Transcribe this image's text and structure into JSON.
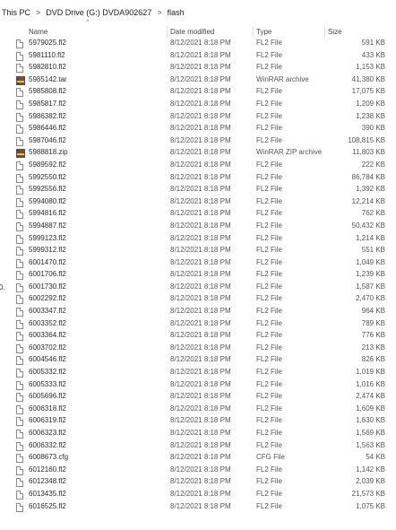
{
  "breadcrumb": [
    "This PC",
    "DVD Drive (G:) DVDA902627",
    "flash"
  ],
  "columns": {
    "name": "Name",
    "date": "Date modified",
    "type": "Type",
    "size": "Size"
  },
  "leftnav_fragment": "0.",
  "files": [
    {
      "name": "5979025.fl2",
      "date": "8/12/2021 8:18 PM",
      "type": "FL2 File",
      "size": "591 KB",
      "icon": "fl2-file-icon"
    },
    {
      "name": "5981110.fl2",
      "date": "8/12/2021 8:18 PM",
      "type": "FL2 File",
      "size": "433 KB",
      "icon": "fl2-file-icon"
    },
    {
      "name": "5982810.fl2",
      "date": "8/12/2021 8:18 PM",
      "type": "FL2 File",
      "size": "1,153 KB",
      "icon": "fl2-file-icon"
    },
    {
      "name": "5985142.tar",
      "date": "8/12/2021 8:18 PM",
      "type": "WinRAR archive",
      "size": "41,380 KB",
      "icon": "winrar-archive-icon"
    },
    {
      "name": "5985808.fl2",
      "date": "8/12/2021 8:18 PM",
      "type": "FL2 File",
      "size": "17,075 KB",
      "icon": "fl2-file-icon"
    },
    {
      "name": "5985817.fl2",
      "date": "8/12/2021 8:18 PM",
      "type": "FL2 File",
      "size": "1,209 KB",
      "icon": "fl2-file-icon"
    },
    {
      "name": "5986382.fl2",
      "date": "8/12/2021 8:18 PM",
      "type": "FL2 File",
      "size": "1,238 KB",
      "icon": "fl2-file-icon"
    },
    {
      "name": "5986446.fl2",
      "date": "8/12/2021 8:18 PM",
      "type": "FL2 File",
      "size": "390 KB",
      "icon": "fl2-file-icon"
    },
    {
      "name": "5987046.fl2",
      "date": "8/12/2021 8:18 PM",
      "type": "FL2 File",
      "size": "108,815 KB",
      "icon": "fl2-file-icon"
    },
    {
      "name": "5988818.zip",
      "date": "8/12/2021 8:18 PM",
      "type": "WinRAR ZIP archive",
      "size": "11,803 KB",
      "icon": "winrar-archive-icon"
    },
    {
      "name": "5989592.fl2",
      "date": "8/12/2021 8:18 PM",
      "type": "FL2 File",
      "size": "222 KB",
      "icon": "fl2-file-icon"
    },
    {
      "name": "5992550.fl2",
      "date": "8/12/2021 8:18 PM",
      "type": "FL2 File",
      "size": "86,784 KB",
      "icon": "fl2-file-icon"
    },
    {
      "name": "5992556.fl2",
      "date": "8/12/2021 8:18 PM",
      "type": "FL2 File",
      "size": "1,392 KB",
      "icon": "fl2-file-icon"
    },
    {
      "name": "5994080.fl2",
      "date": "8/12/2021 8:18 PM",
      "type": "FL2 File",
      "size": "12,214 KB",
      "icon": "fl2-file-icon"
    },
    {
      "name": "5994816.fl2",
      "date": "8/12/2021 8:18 PM",
      "type": "FL2 File",
      "size": "762 KB",
      "icon": "fl2-file-icon"
    },
    {
      "name": "5994887.fl2",
      "date": "8/12/2021 8:18 PM",
      "type": "FL2 File",
      "size": "50,432 KB",
      "icon": "fl2-file-icon"
    },
    {
      "name": "5999123.fl2",
      "date": "8/12/2021 8:18 PM",
      "type": "FL2 File",
      "size": "1,214 KB",
      "icon": "fl2-file-icon"
    },
    {
      "name": "5999312.fl2",
      "date": "8/12/2021 8:18 PM",
      "type": "FL2 File",
      "size": "551 KB",
      "icon": "fl2-file-icon"
    },
    {
      "name": "6001470.fl2",
      "date": "8/12/2021 8:18 PM",
      "type": "FL2 File",
      "size": "1,049 KB",
      "icon": "fl2-file-icon"
    },
    {
      "name": "6001706.fl2",
      "date": "8/12/2021 8:18 PM",
      "type": "FL2 File",
      "size": "1,239 KB",
      "icon": "fl2-file-icon"
    },
    {
      "name": "6001730.fl2",
      "date": "8/12/2021 8:18 PM",
      "type": "FL2 File",
      "size": "1,587 KB",
      "icon": "fl2-file-icon"
    },
    {
      "name": "6002292.fl2",
      "date": "8/12/2021 8:18 PM",
      "type": "FL2 File",
      "size": "2,470 KB",
      "icon": "fl2-file-icon"
    },
    {
      "name": "6003347.fl2",
      "date": "8/12/2021 8:18 PM",
      "type": "FL2 File",
      "size": "964 KB",
      "icon": "fl2-file-icon"
    },
    {
      "name": "6003352.fl2",
      "date": "8/12/2021 8:18 PM",
      "type": "FL2 File",
      "size": "789 KB",
      "icon": "fl2-file-icon"
    },
    {
      "name": "6003364.fl2",
      "date": "8/12/2021 8:18 PM",
      "type": "FL2 File",
      "size": "776 KB",
      "icon": "fl2-file-icon"
    },
    {
      "name": "6003702.fl2",
      "date": "8/12/2021 8:18 PM",
      "type": "FL2 File",
      "size": "213 KB",
      "icon": "fl2-file-icon"
    },
    {
      "name": "6004546.fl2",
      "date": "8/12/2021 8:18 PM",
      "type": "FL2 File",
      "size": "826 KB",
      "icon": "fl2-file-icon"
    },
    {
      "name": "6005332.fl2",
      "date": "8/12/2021 8:18 PM",
      "type": "FL2 File",
      "size": "1,019 KB",
      "icon": "fl2-file-icon"
    },
    {
      "name": "6005333.fl2",
      "date": "8/12/2021 8:18 PM",
      "type": "FL2 File",
      "size": "1,016 KB",
      "icon": "fl2-file-icon"
    },
    {
      "name": "6005696.fl2",
      "date": "8/12/2021 8:18 PM",
      "type": "FL2 File",
      "size": "2,474 KB",
      "icon": "fl2-file-icon"
    },
    {
      "name": "6006318.fl2",
      "date": "8/12/2021 8:18 PM",
      "type": "FL2 File",
      "size": "1,609 KB",
      "icon": "fl2-file-icon"
    },
    {
      "name": "6006319.fl2",
      "date": "8/12/2021 8:18 PM",
      "type": "FL2 File",
      "size": "1,630 KB",
      "icon": "fl2-file-icon"
    },
    {
      "name": "6006323.fl2",
      "date": "8/12/2021 8:18 PM",
      "type": "FL2 File",
      "size": "1,569 KB",
      "icon": "fl2-file-icon"
    },
    {
      "name": "6006332.fl2",
      "date": "8/12/2021 8:18 PM",
      "type": "FL2 File",
      "size": "1,563 KB",
      "icon": "fl2-file-icon"
    },
    {
      "name": "6008673.cfg",
      "date": "8/12/2021 8:18 PM",
      "type": "CFG File",
      "size": "54 KB",
      "icon": "cfg-file-icon"
    },
    {
      "name": "6012160.fl2",
      "date": "8/12/2021 8:18 PM",
      "type": "FL2 File",
      "size": "1,142 KB",
      "icon": "fl2-file-icon"
    },
    {
      "name": "6012348.fl2",
      "date": "8/12/2021 8:18 PM",
      "type": "FL2 File",
      "size": "2,039 KB",
      "icon": "fl2-file-icon"
    },
    {
      "name": "6013435.fl2",
      "date": "8/12/2021 8:18 PM",
      "type": "FL2 File",
      "size": "21,573 KB",
      "icon": "fl2-file-icon"
    },
    {
      "name": "6016525.fl2",
      "date": "8/12/2021 8:18 PM",
      "type": "FL2 File",
      "size": "1,075 KB",
      "icon": "fl2-file-icon"
    }
  ]
}
